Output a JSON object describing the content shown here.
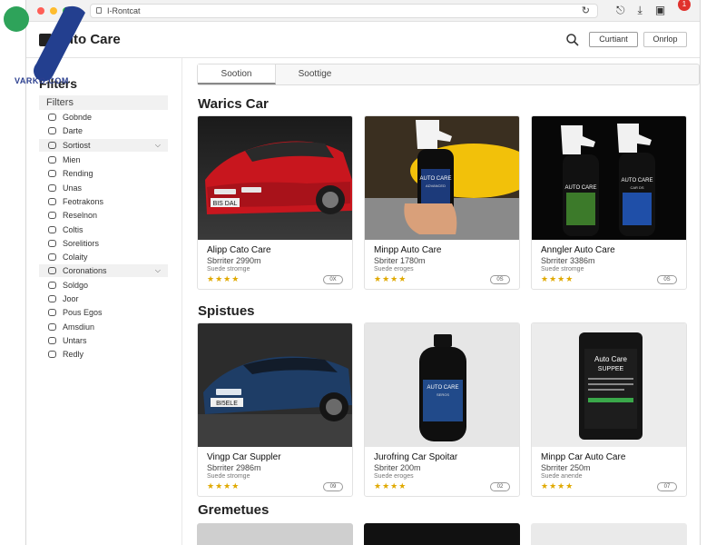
{
  "browser": {
    "url": "I-Rontcat",
    "notification_count": "1"
  },
  "header": {
    "brand": "Auto Care",
    "buttons": [
      "Curtiant",
      "Onrlop"
    ]
  },
  "sidebar": {
    "title": "Filters",
    "subtitle": "Filters",
    "items": [
      {
        "label": "Gobnde",
        "group": false
      },
      {
        "label": "Darte",
        "group": false
      },
      {
        "label": "Sortiost",
        "group": true
      },
      {
        "label": "Mien",
        "group": false
      },
      {
        "label": "Rending",
        "group": false
      },
      {
        "label": "Unas",
        "group": false
      },
      {
        "label": "Feotrakons",
        "group": false
      },
      {
        "label": "Reselnon",
        "group": false
      },
      {
        "label": "Coltis",
        "group": false
      },
      {
        "label": "Sorelitiors",
        "group": false
      },
      {
        "label": "Colaity",
        "group": false
      },
      {
        "label": "Coronations",
        "group": true
      },
      {
        "label": "Soldgo",
        "group": false
      },
      {
        "label": "Joor",
        "group": false
      },
      {
        "label": "Pous Egos",
        "group": false
      },
      {
        "label": "Amsdiun",
        "group": false
      },
      {
        "label": "Untars",
        "group": false
      },
      {
        "label": "Redly",
        "group": false
      }
    ]
  },
  "tabs": [
    "Sootion",
    "Soottige"
  ],
  "sections": [
    {
      "title": "Warics Car",
      "cards": [
        {
          "name": "Alipp Cato Care",
          "sub": "Sbrriter 2990m",
          "meta": "Suede stromge",
          "pill": "0X",
          "image": "red-car"
        },
        {
          "name": "Minpp Auto Care",
          "sub": "Sbriter 1780m",
          "meta": "Suede eroges",
          "pill": "0S",
          "image": "spray-hand"
        },
        {
          "name": "Anngler Auto Care",
          "sub": "Sbrriter 3386m",
          "meta": "Suede stromge",
          "pill": "0S",
          "image": "spray-pair"
        }
      ]
    },
    {
      "title": "Spistues",
      "cards": [
        {
          "name": "Vingp Car Suppler",
          "sub": "Sbrriter 2986m",
          "meta": "Suede stromge",
          "pill": "09",
          "image": "blue-car"
        },
        {
          "name": "Jurofring Car Spoitar",
          "sub": "Sbriter 200m",
          "meta": "Suede eroges",
          "pill": "02",
          "image": "bottle"
        },
        {
          "name": "Minpp Car Auto Care",
          "sub": "Sbrriter 250m",
          "meta": "Suede anende",
          "pill": "07",
          "image": "supply-box"
        }
      ]
    },
    {
      "title": "Gremetues"
    }
  ],
  "card_label_texts": {
    "label_1": "BIS DAL",
    "label_2": "BI5ELE",
    "spray_brand": "AUTO CARE",
    "spray_sub": "ADVANCED",
    "spray_left": "AUTO CARE",
    "spray_right": "AUTO CARE",
    "spray_right_sub": "CAR DS",
    "bottle_brand": "AUTO CARE",
    "bottle_sub": "SEROS",
    "box_brand": "Auto Care",
    "box_sub": "SUPPEE"
  },
  "overlay": {
    "text": "VARKO.COM"
  },
  "colors": {
    "star": "#e0a900",
    "badge": "#e0322d",
    "red_car": "#d01a22",
    "blue_car": "#1e3d66"
  }
}
